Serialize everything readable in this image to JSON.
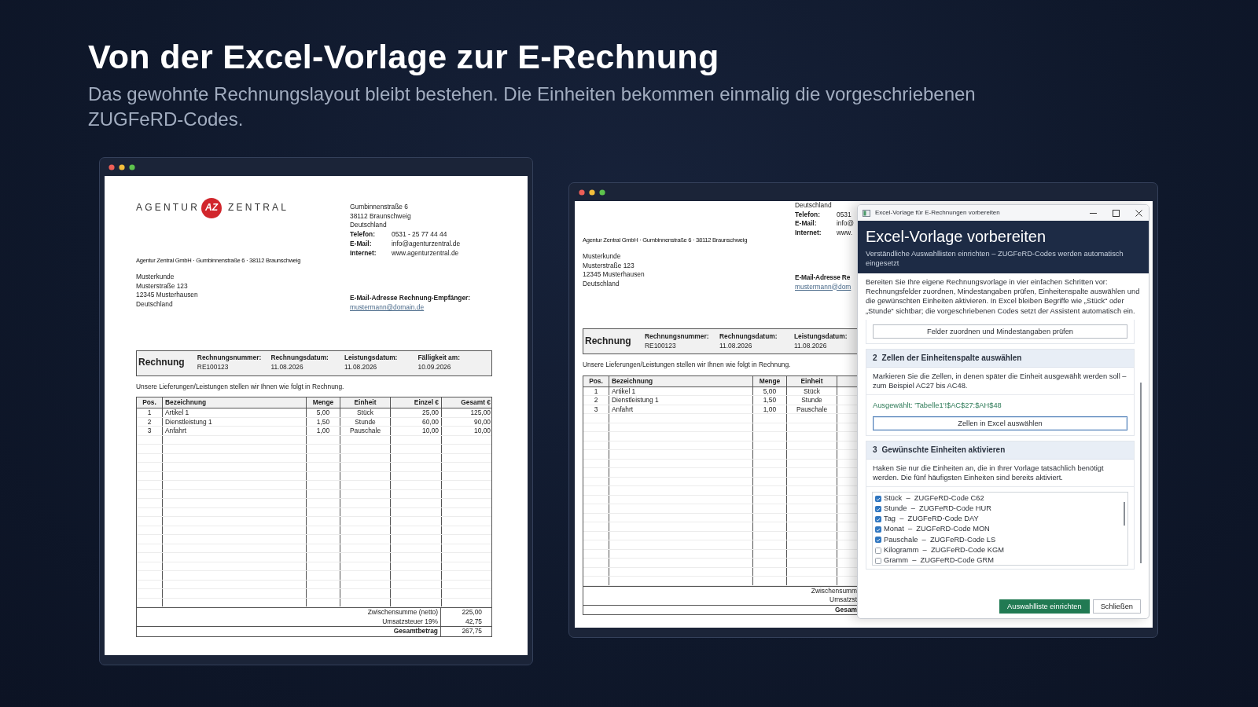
{
  "heading": {
    "title": "Von der Excel-Vorlage zur E-Rechnung",
    "subtitle": "Das gewohnte Rechnungslayout bleibt bestehen. Die Einheiten bekommen einmalig die vorgeschriebenen ZUGFeRD-Codes."
  },
  "documents": [
    {
      "cropped": false,
      "logo": {
        "left": "AGENTUR",
        "mark": "AZ",
        "right": "ZENTRAL"
      },
      "sender_address": [
        "Gumbinnenstraße 6",
        "38112 Braunschweig",
        "Deutschland"
      ],
      "contact": [
        {
          "label": "Telefon:",
          "value": "0531 - 25 77 44 44"
        },
        {
          "label": "E-Mail:",
          "value": "info@agenturzentral.de"
        },
        {
          "label": "Internet:",
          "value": "www.agenturzentral.de"
        }
      ],
      "return_line": "Agentur Zentral GmbH · Gumbinnenstraße 6 · 38112 Braunschweig",
      "recipient": [
        "Musterkunde",
        "Musterstraße 123",
        "12345 Musterhausen",
        "Deutschland"
      ],
      "email_label": "E-Mail-Adresse Rechnung-Empfänger:",
      "email": "mustermann@domain.de",
      "title": "Rechnung",
      "meta": [
        {
          "label": "Rechnungsnummer:",
          "value": "RE100123"
        },
        {
          "label": "Rechnungsdatum:",
          "value": "11.08.2026"
        },
        {
          "label": "Leistungsdatum:",
          "value": "11.08.2026"
        },
        {
          "label": "Fälligkeit am:",
          "value": "10.09.2026"
        }
      ],
      "intro": "Unsere Lieferungen/Leistungen stellen wir Ihnen wie folgt in Rechnung.",
      "columns": [
        {
          "label": "Pos."
        },
        {
          "label": "Bezeichnung"
        },
        {
          "label": "Menge"
        },
        {
          "label": "Einheit"
        },
        {
          "label": "Einzel €"
        },
        {
          "label": "Gesamt €"
        }
      ],
      "rows": [
        [
          "1",
          "Artikel 1",
          "5,00",
          "Stück",
          "25,00",
          "125,00"
        ],
        [
          "2",
          "Dienstleistung 1",
          "1,50",
          "Stunde",
          "60,00",
          "90,00"
        ],
        [
          "3",
          "Anfahrt",
          "1,00",
          "Pauschale",
          "10,00",
          "10,00"
        ]
      ],
      "totals": [
        {
          "label": "Zwischensumme (netto)",
          "value": "225,00",
          "kind": "subtotal"
        },
        {
          "label": "Umsatzsteuer 19%",
          "value": "42,75",
          "kind": "subtotal"
        },
        {
          "label": "Gesamtbetrag",
          "value": "267,75",
          "kind": "grand"
        }
      ]
    },
    {
      "cropped": true,
      "sender_address": [
        "Deutschland"
      ],
      "contact": [
        {
          "label": "Telefon:",
          "value": "0531"
        },
        {
          "label": "E-Mail:",
          "value": "info@"
        },
        {
          "label": "Internet:",
          "value": "www."
        }
      ],
      "return_line": "Agentur Zentral GmbH · Gumbinnenstraße 6 · 38112 Braunschweig",
      "recipient": [
        "Musterkunde",
        "Musterstraße 123",
        "12345 Musterhausen",
        "Deutschland"
      ],
      "email_label": "E-Mail-Adresse Re",
      "email": "mustermann@dom",
      "title": "Rechnung",
      "meta": [
        {
          "label": "Rechnungsnummer:",
          "value": "RE100123"
        },
        {
          "label": "Rechnungsdatum:",
          "value": "11.08.2026"
        },
        {
          "label": "Leistungsdatum:",
          "value": "11.08.2026"
        }
      ],
      "intro": "Unsere Lieferungen/Leistungen stellen wir Ihnen wie folgt in Rechnung.",
      "columns": [
        {
          "label": "Pos."
        },
        {
          "label": "Bezeichnung"
        },
        {
          "label": "Menge"
        },
        {
          "label": "Einheit"
        }
      ],
      "rows": [
        [
          "1",
          "Artikel 1",
          "5,00",
          "Stück"
        ],
        [
          "2",
          "Dienstleistung 1",
          "1,50",
          "Stunde"
        ],
        [
          "3",
          "Anfahrt",
          "1,00",
          "Pauschale"
        ]
      ],
      "totals": [
        {
          "label": "Zwischensumm",
          "kind": "subtotal"
        },
        {
          "label": "Umsatzst",
          "kind": "subtotal"
        },
        {
          "label": "Gesam",
          "kind": "grand"
        }
      ]
    }
  ],
  "dialog": {
    "window_title": "Excel-Vorlage für E-Rechnungen vorbereiten",
    "title": "Excel-Vorlage vorbereiten",
    "subtitle": "Verständliche Auswahllisten einrichten – ZUGFeRD-Codes werden automatisch eingesetzt",
    "intro": "Bereiten Sie Ihre eigene Rechnungsvorlage in vier einfachen Schritten vor: Rechnungsfelder zuordnen, Mindestangaben prüfen, Einheitenspalte auswählen und die gewünschten Einheiten aktivieren. In Excel bleiben Begriffe wie „Stück“ oder „Stunde“ sichtbar; die vorgeschriebenen Codes setzt der Assistent automatisch ein.",
    "sections": [
      {
        "button": {
          "label": "Felder zuordnen und Mindestangaben prüfen",
          "focused": false
        }
      },
      {
        "number": "2",
        "title": "Zellen der Einheitenspalte auswählen",
        "description": "Markieren Sie die Zellen, in denen später die Einheit ausgewählt werden soll – zum Beispiel AC27 bis AC48.",
        "selection": "Ausgewählt: 'Tabelle1'!$AC$27:$AH$48",
        "button": {
          "label": "Zellen in Excel auswählen",
          "focused": true
        }
      },
      {
        "number": "3",
        "title": "Gewünschte Einheiten aktivieren",
        "description": "Haken Sie nur die Einheiten an, die in Ihrer Vorlage tatsächlich benötigt werden. Die fünf häufigsten Einheiten sind bereits aktiviert.",
        "options": [
          {
            "label": "Stück  –  ZUGFeRD-Code C62",
            "checked": true
          },
          {
            "label": "Stunde  –  ZUGFeRD-Code HUR",
            "checked": true
          },
          {
            "label": "Tag  –  ZUGFeRD-Code DAY",
            "checked": true
          },
          {
            "label": "Monat  –  ZUGFeRD-Code MON",
            "checked": true
          },
          {
            "label": "Pauschale  –  ZUGFeRD-Code LS",
            "checked": true
          },
          {
            "label": "Kilogramm  –  ZUGFeRD-Code KGM",
            "checked": false
          },
          {
            "label": "Gramm  –  ZUGFeRD-Code GRM",
            "checked": false
          }
        ]
      }
    ],
    "buttons": [
      {
        "label": "Auswahlliste einrichten",
        "kind": "primary"
      },
      {
        "label": "Schließen",
        "kind": "secondary"
      }
    ]
  }
}
